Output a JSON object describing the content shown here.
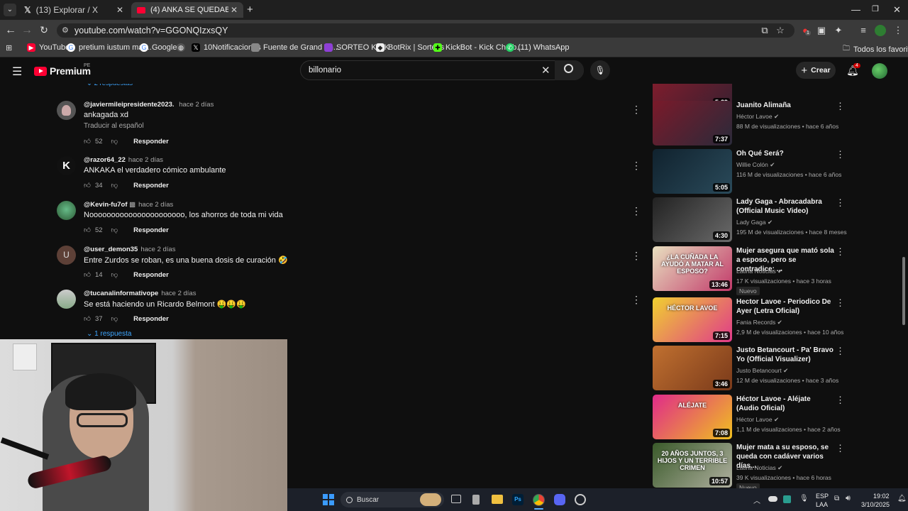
{
  "browser": {
    "tabs": [
      {
        "title": "(13) Explorar / X"
      },
      {
        "title": "(4) ANKA SE QUEDABA CON LA"
      }
    ],
    "url": "youtube.com/watch?v=GGONQIzxsQY",
    "bookmarks": [
      {
        "label": "YouTube"
      },
      {
        "label": "pretium iustum mat..."
      },
      {
        "label": "Google"
      },
      {
        "label": ""
      },
      {
        "label": "10Notificaciones"
      },
      {
        "label": "Fuente de Grand Th..."
      },
      {
        "label": "SORTEO KICK"
      },
      {
        "label": "BotRix | Sorteos"
      },
      {
        "label": "KickBot - Kick Chatb..."
      },
      {
        "label": "(11) WhatsApp"
      }
    ],
    "all_favorites": "Todos los favoritos",
    "ext_badge": "1"
  },
  "youtube": {
    "logo": "Premium",
    "region": "PE",
    "search_value": "billonario",
    "create_label": "Crear",
    "notif_count": "4"
  },
  "comments": {
    "top_replies": "2 respuestas",
    "items": [
      {
        "user": "@javiermileipresidente2023",
        "time": "hace 2 días",
        "text": "ankagada xd",
        "translate": "Traducir al español",
        "likes": "52",
        "reply": "Responder"
      },
      {
        "user": "@razor64_22",
        "time": "hace 2 días",
        "text": "ANKAKA el verdadero cómico ambulante",
        "likes": "34",
        "reply": "Responder"
      },
      {
        "user": "@Kevin-fu7of",
        "time": "hace 2 días",
        "text": "Noooooooooooooooooooooo, los ahorros de toda mi vida",
        "likes": "52",
        "reply": "Responder"
      },
      {
        "user": "@user_demon35",
        "time": "hace 2 días",
        "text": "Entre Zurdos se roban, es una buena dosis de curación 🤣",
        "likes": "14",
        "reply": "Responder",
        "avatar_letter": "U"
      },
      {
        "user": "@tucanalinformativope",
        "time": "hace 2 días",
        "text": "Se está haciendo un Ricardo Belmont 🤑🤑🤑",
        "likes": "37",
        "reply": "Responder"
      }
    ],
    "bottom_replies": "1 respuesta"
  },
  "videos": [
    {
      "title": "",
      "duration": "5:29",
      "channel": "",
      "views": "",
      "colors": [
        "#8a1c2c",
        "#3a2030"
      ]
    },
    {
      "title": "Juanito Alimaña",
      "channel": "Héctor Lavoe",
      "views": "88 M de visualizaciones • hace 6 años",
      "duration": "7:37",
      "colors": [
        "#7a1a2a",
        "#2a2a3a"
      ]
    },
    {
      "title": "Oh Qué Será?",
      "channel": "Willie Colón",
      "views": "116 M de visualizaciones • hace 6 años",
      "duration": "5:05",
      "colors": [
        "#10222e",
        "#2a4a5a"
      ]
    },
    {
      "title": "Lady Gaga - Abracadabra (Official Music Video)",
      "channel": "Lady Gaga",
      "views": "195 M de visualizaciones • hace 8 meses",
      "duration": "4:30",
      "colors": [
        "#222222",
        "#6a6a6a"
      ]
    },
    {
      "title": "Mujer asegura que mató sola a esposo, pero se contradice: ...",
      "channel": "Latina Noticias",
      "views": "17 K visualizaciones • hace 3 horas",
      "duration": "13:46",
      "badge": "Nuevo",
      "colors": [
        "#e8e0c0",
        "#c23a6a"
      ],
      "overlay": "¿LA CUÑADA LA AYUDÓ A MATAR AL ESPOSO?"
    },
    {
      "title": "Hector Lavoe - Periodico De Ayer (Letra Oficial)",
      "channel": "Fania Records",
      "views": "2,9 M de visualizaciones • hace 10 años",
      "duration": "7:15",
      "colors": [
        "#f0d030",
        "#e03a8a"
      ],
      "overlay": "HÉCTOR LAVOE"
    },
    {
      "title": "Justo Betancourt - Pa' Bravo Yo (Official Visualizer)",
      "channel": "Justo Betancourt",
      "views": "12 M de visualizaciones • hace 3 años",
      "duration": "3:46",
      "colors": [
        "#c07030",
        "#7a3a1a"
      ]
    },
    {
      "title": "Héctor Lavoe - Aléjate (Audio Oficial)",
      "channel": "Héctor Lavoe",
      "views": "1,1 M de visualizaciones • hace 2 años",
      "duration": "7:08",
      "colors": [
        "#e02a8a",
        "#f0c020"
      ],
      "overlay": "ALÉJATE"
    },
    {
      "title": "Mujer mata a su esposo, se queda con cadáver varios días...",
      "channel": "Latina Noticias",
      "views": "39 K visualizaciones • hace 6 horas",
      "duration": "10:57",
      "badge": "Nuevo",
      "colors": [
        "#3a5a2a",
        "#b0b0a0"
      ],
      "overlay": "20 AÑOS JUNTOS, 3 HIJOS Y UN TERRIBLE CRIMEN"
    }
  ],
  "taskbar": {
    "search_label": "Buscar",
    "lang1": "ESP",
    "lang2": "LAA",
    "time": "19:02",
    "date": "3/10/2025"
  }
}
